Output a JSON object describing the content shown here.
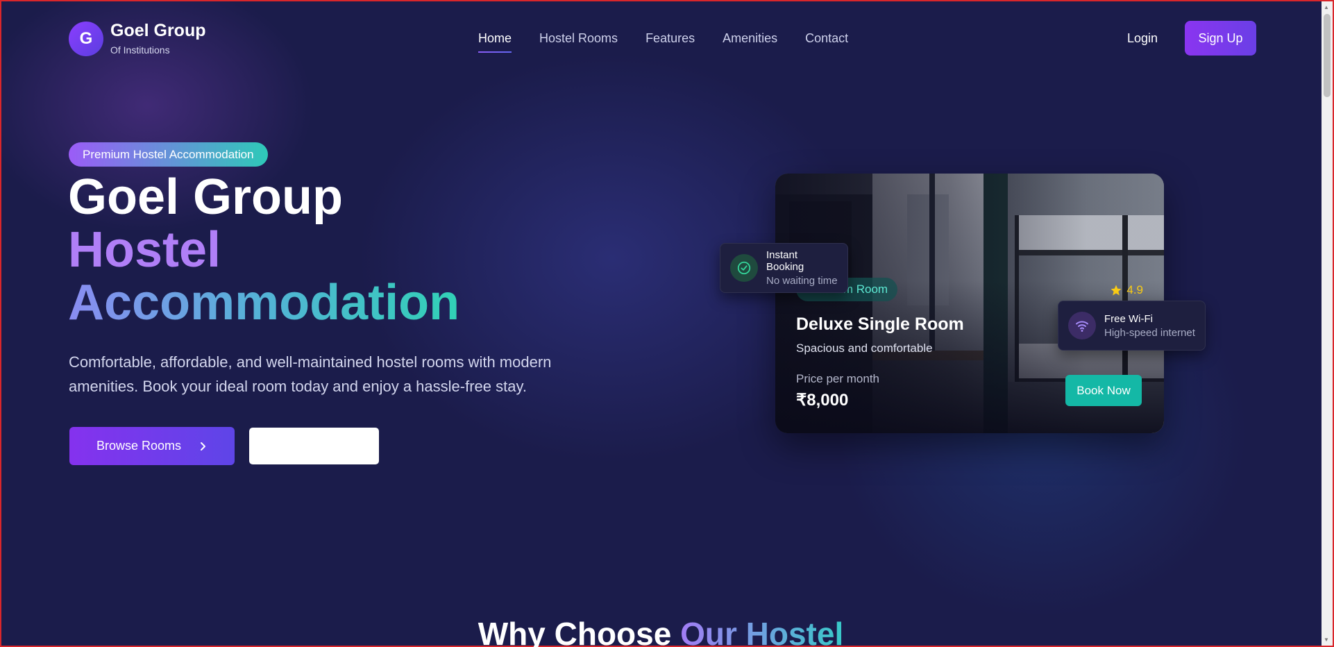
{
  "brand": {
    "logo_letter": "G",
    "name": "Goel Group",
    "subtitle": "Of Institutions"
  },
  "nav": {
    "links": [
      {
        "label": "Home",
        "active": true
      },
      {
        "label": "Hostel Rooms",
        "active": false
      },
      {
        "label": "Features",
        "active": false
      },
      {
        "label": "Amenities",
        "active": false
      },
      {
        "label": "Contact",
        "active": false
      }
    ],
    "login_label": "Login",
    "signup_label": "Sign Up"
  },
  "hero": {
    "badge": "Premium Hostel Accommodation",
    "title_line1": "Goel Group",
    "title_line2": "Hostel",
    "title_line3": "Accommodation",
    "description": "Comfortable, affordable, and well-maintained hostel rooms with modern amenities. Book your ideal room today and enjoy a hassle-free stay.",
    "browse_label": "Browse Rooms",
    "browse_icon": "chevron-right-icon",
    "secondary_label": ""
  },
  "room_card": {
    "badge": "Premium Room",
    "rating": "4.9",
    "rating_icon": "star-icon",
    "title": "Deluxe Single Room",
    "subtitle": "Spacious and comfortable",
    "price_label": "Price per month",
    "price": "₹8,000",
    "book_label": "Book Now"
  },
  "floating_cards": [
    {
      "icon": "check-circle-icon",
      "title": "Instant Booking",
      "subtitle": "No waiting time"
    },
    {
      "icon": "wifi-icon",
      "title": "Free Wi-Fi",
      "subtitle": "High-speed internet"
    }
  ],
  "section": {
    "title_part1": "Why Choose ",
    "title_accent": "Our Hostel"
  },
  "colors": {
    "background": "#1b1c4b",
    "primary": "#7c3aed",
    "teal": "#14b8a6",
    "accent_purple": "#b07ff7",
    "star": "#facc15"
  }
}
